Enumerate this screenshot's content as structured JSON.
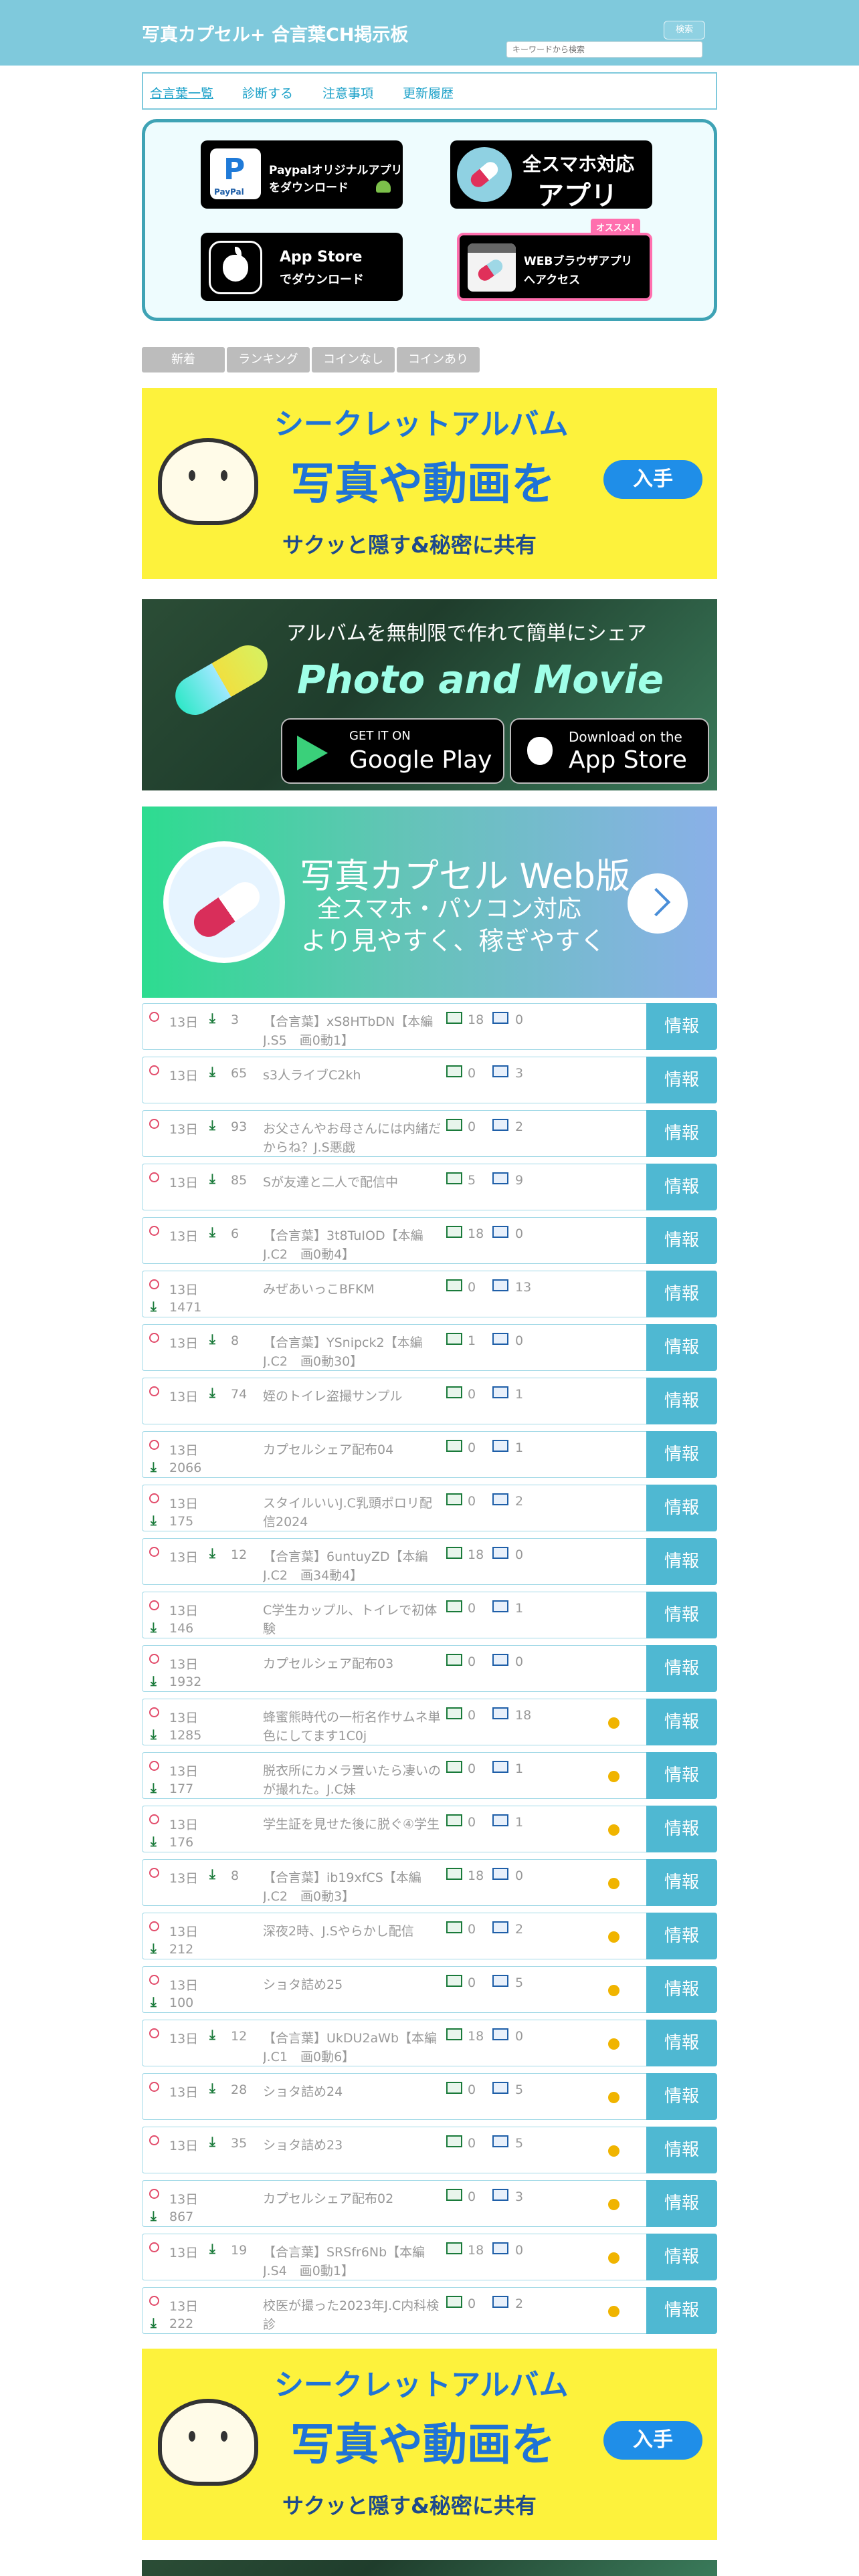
{
  "header": {
    "title": "写真カプセル+ 合言葉CH掲示板",
    "search_button": "検索",
    "search_placeholder": "キーワードから検索"
  },
  "nav": [
    "合言葉一覧",
    "診断する",
    "注意事項",
    "更新履歴"
  ],
  "apps": {
    "paypal": {
      "line1": "Paypalオリジナルアプリ",
      "line2": "をダウンロード",
      "logo": "P",
      "logo_sub": "PayPal"
    },
    "phone_app": {
      "line1": "全スマホ対応",
      "line2": "アプリ"
    },
    "appstore": {
      "line1": "App Store",
      "line2": "でダウンロード"
    },
    "web_app": {
      "line1": "WEBブラウザアプリ",
      "line2": "へアクセス",
      "badge": "オススメ!"
    }
  },
  "filter_tabs": [
    "新着",
    "ランキング",
    "コインなし",
    "コインあり"
  ],
  "banners": {
    "secret_album": {
      "line1": "シークレットアルバム",
      "line2": "写真や動画を",
      "line3": "サクッと隠す&秘密に共有",
      "cta": "入手"
    },
    "photo_movie": {
      "line1": "アルバムを無制限で作れて簡単にシェア",
      "line2": "Photo and Movie",
      "gp_small": "GET IT ON",
      "gp_big": "Google Play",
      "as_small": "Download on the",
      "as_big": "App Store"
    },
    "web_version": {
      "line1": "写真カプセル Web版",
      "line2": "全スマホ・パソコン対応",
      "line3": "より見やすく、稼ぎやすく"
    }
  },
  "detail_label": "情報",
  "rows": [
    {
      "days": "13日",
      "dl": "3",
      "title": "【合言葉】xS8HTbDN【本編　J.S5　画0動1】",
      "img": "18",
      "vid": "0",
      "coin": false,
      "wrap": false
    },
    {
      "days": "13日",
      "dl": "65",
      "title": "s3人ライブC2kh",
      "img": "0",
      "vid": "3",
      "coin": false,
      "wrap": false
    },
    {
      "days": "13日",
      "dl": "93",
      "title": "お父さんやお母さんには内緒だからね？J.S悪戯",
      "img": "0",
      "vid": "2",
      "coin": false,
      "wrap": false
    },
    {
      "days": "13日",
      "dl": "85",
      "title": "Sが友達と二人で配信中",
      "img": "5",
      "vid": "9",
      "coin": false,
      "wrap": false
    },
    {
      "days": "13日",
      "dl": "6",
      "title": "【合言葉】3t8TuIOD【本編　J.C2　画0動4】",
      "img": "18",
      "vid": "0",
      "coin": false,
      "wrap": false
    },
    {
      "days": "13日",
      "dl": "1471",
      "title": "みぜあいっこBFKM",
      "img": "0",
      "vid": "13",
      "coin": false,
      "wrap": true
    },
    {
      "days": "13日",
      "dl": "8",
      "title": "【合言葉】YSnipck2【本編　J.C2　画0動30】",
      "img": "1",
      "vid": "0",
      "coin": false,
      "wrap": false
    },
    {
      "days": "13日",
      "dl": "74",
      "title": "姪のトイレ盗撮サンプル",
      "img": "0",
      "vid": "1",
      "coin": false,
      "wrap": false
    },
    {
      "days": "13日",
      "dl": "2066",
      "title": "カプセルシェア配布04",
      "img": "0",
      "vid": "1",
      "coin": false,
      "wrap": true
    },
    {
      "days": "13日",
      "dl": "175",
      "title": "スタイルいいJ.C乳頭ポロリ配信2024",
      "img": "0",
      "vid": "2",
      "coin": false,
      "wrap": true
    },
    {
      "days": "13日",
      "dl": "12",
      "title": "【合言葉】6untuyZD【本編　J.C2　画34動4】",
      "img": "18",
      "vid": "0",
      "coin": false,
      "wrap": false
    },
    {
      "days": "13日",
      "dl": "146",
      "title": "C学生カップル、トイレで初体験",
      "img": "0",
      "vid": "1",
      "coin": false,
      "wrap": true
    },
    {
      "days": "13日",
      "dl": "1932",
      "title": "カプセルシェア配布03",
      "img": "0",
      "vid": "0",
      "coin": false,
      "wrap": true
    },
    {
      "days": "13日",
      "dl": "1285",
      "title": "蜂蜜熊時代の一桁名作サムネ単色にしてます1C0j",
      "img": "0",
      "vid": "18",
      "coin": true,
      "wrap": true
    },
    {
      "days": "13日",
      "dl": "177",
      "title": "脱衣所にカメラ置いたら凄いのが撮れた。J.C妹",
      "img": "0",
      "vid": "1",
      "coin": true,
      "wrap": true
    },
    {
      "days": "13日",
      "dl": "176",
      "title": "学生証を見せた後に脱ぐ④学生",
      "img": "0",
      "vid": "1",
      "coin": true,
      "wrap": true
    },
    {
      "days": "13日",
      "dl": "8",
      "title": "【合言葉】ib19xfCS【本編　J.C2　画0動3】",
      "img": "18",
      "vid": "0",
      "coin": true,
      "wrap": false
    },
    {
      "days": "13日",
      "dl": "212",
      "title": "深夜2時、J.Sやらかし配信",
      "img": "0",
      "vid": "2",
      "coin": true,
      "wrap": true
    },
    {
      "days": "13日",
      "dl": "100",
      "title": "ショタ詰め25",
      "img": "0",
      "vid": "5",
      "coin": true,
      "wrap": true
    },
    {
      "days": "13日",
      "dl": "12",
      "title": "【合言葉】UkDU2aWb【本編　J.C1　画0動6】",
      "img": "18",
      "vid": "0",
      "coin": true,
      "wrap": false
    },
    {
      "days": "13日",
      "dl": "28",
      "title": "ショタ詰め24",
      "img": "0",
      "vid": "5",
      "coin": true,
      "wrap": false
    },
    {
      "days": "13日",
      "dl": "35",
      "title": "ショタ詰め23",
      "img": "0",
      "vid": "5",
      "coin": true,
      "wrap": false
    },
    {
      "days": "13日",
      "dl": "867",
      "title": "カプセルシェア配布02",
      "img": "0",
      "vid": "3",
      "coin": true,
      "wrap": true
    },
    {
      "days": "13日",
      "dl": "19",
      "title": "【合言葉】SRSfr6Nb【本編　J.S4　画0動1】",
      "img": "18",
      "vid": "0",
      "coin": true,
      "wrap": false
    },
    {
      "days": "13日",
      "dl": "222",
      "title": "校医が撮った2023年J.C内科検診",
      "img": "0",
      "vid": "2",
      "coin": true,
      "wrap": true
    }
  ],
  "colors": {
    "header": "#7fc9dc",
    "detail": "#4fb8d2",
    "accent_blue": "#1f73d6",
    "coin": "#f0b400"
  }
}
